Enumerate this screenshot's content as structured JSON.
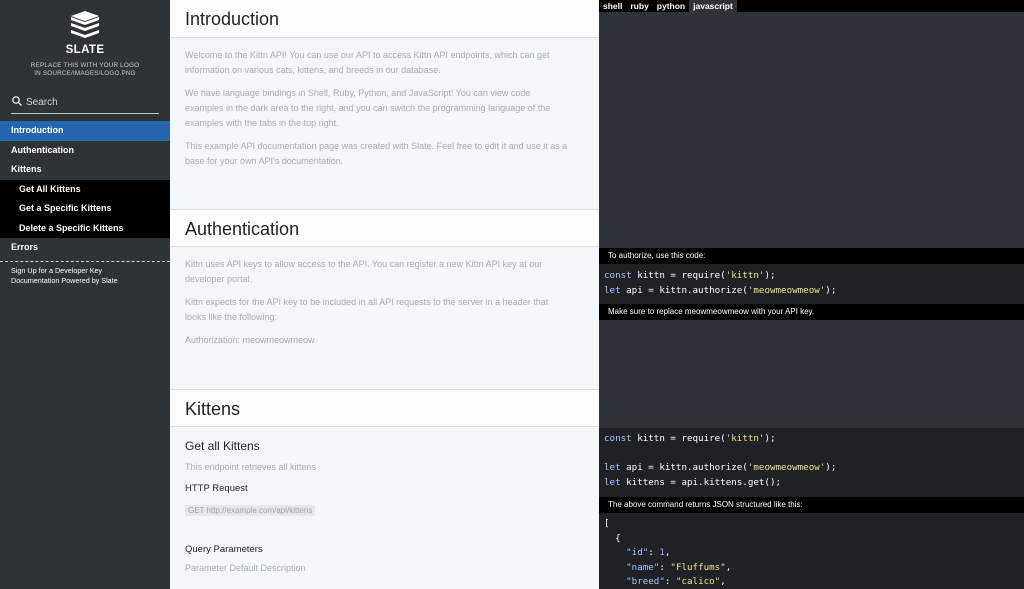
{
  "sidebar": {
    "logo_title": "SLATE",
    "logo_sub1": "REPLACE THIS WITH YOUR LOGO",
    "logo_sub2": "IN SOURCE/IMAGES/LOGO.PNG",
    "search_placeholder": "Search",
    "toc": {
      "introduction": "Introduction",
      "authentication": "Authentication",
      "kittens": "Kittens",
      "get_all": "Get All Kittens",
      "get_specific": "Get a Specific Kittens",
      "delete_specific": "Delete a Specific Kittens",
      "errors": "Errors"
    },
    "footer": {
      "signup": "Sign Up for a Developer Key",
      "powered": "Documentation Powered by Slate"
    }
  },
  "main": {
    "intro_title": "Introduction",
    "intro_p1a": "Welcome to the Kittn API! You can use our API to access Kittn API endpoints, which can get",
    "intro_p1b": "information on various cats, kittens, and breeds in our database.",
    "intro_p2a": "We have language bindings in Shell, Ruby, Python, and JavaScript! You can view code",
    "intro_p2b": "examples in the dark area to the right, and you can switch the programming language of the",
    "intro_p2c": "examples with the tabs in the top right.",
    "intro_p3a": "This example API documentation page was created with Slate. Feel free to edit it and use it as a",
    "intro_p3b": "base for your own API's documentation.",
    "auth_title": "Authentication",
    "auth_p1a": "Kittn uses API keys to allow access to the API. You can register a new Kittn API key at our",
    "auth_p1b": "developer portal.",
    "auth_p2a": "Kittn expects for the API key to be included in all API requests to the server in a header that",
    "auth_p2b": "looks like the following:",
    "auth_p3": "Authorization: meowmeowmeow",
    "kittens_title": "Kittens",
    "get_all_title": "Get all Kittens",
    "get_all_desc": "This endpoint retrieves all kittens",
    "http_request_title": "HTTP Request",
    "http_request_code": "GET http://example.com/api/kittens",
    "query_params_title": "Query Parameters",
    "query_params_header": "Parameter Default Description"
  },
  "code": {
    "tabs": [
      "shell",
      "ruby",
      "python",
      "javascript"
    ],
    "note_authorize": "To authorize, use this code:",
    "note_replace": "Make sure to replace meowmeowmeow with your API key.",
    "note_returns": "The above command returns JSON structured like this:",
    "auth_line1": {
      "kw": "const",
      "mid": " kittn = require(",
      "str": "'kittn'",
      "end": ");"
    },
    "auth_line2": {
      "kw": "let",
      "mid": " api = kittn.authorize(",
      "str": "'meowmeowmeow'",
      "end": ");"
    },
    "kit_line1": {
      "kw": "const",
      "mid": " kittn = require(",
      "str": "'kittn'",
      "end": ");"
    },
    "kit_line2": {
      "kw": "let",
      "mid": " api = kittn.authorize(",
      "str": "'meowmeowmeow'",
      "end": ");"
    },
    "kit_line3": {
      "kw": "let",
      "mid": " kittens = api.kittens.get();"
    },
    "json": {
      "open_bracket": "[",
      "open_brace": "  {",
      "id_key": "\"id\"",
      "id_val": "1",
      "name_key": "\"name\"",
      "name_val": "\"Fluffums\"",
      "breed_key": "\"breed\"",
      "breed_val": "\"calico\""
    }
  },
  "colors": {
    "sidebar_bg": "#2e3336",
    "active": "#2467af",
    "code_bg": "#2f3339"
  }
}
